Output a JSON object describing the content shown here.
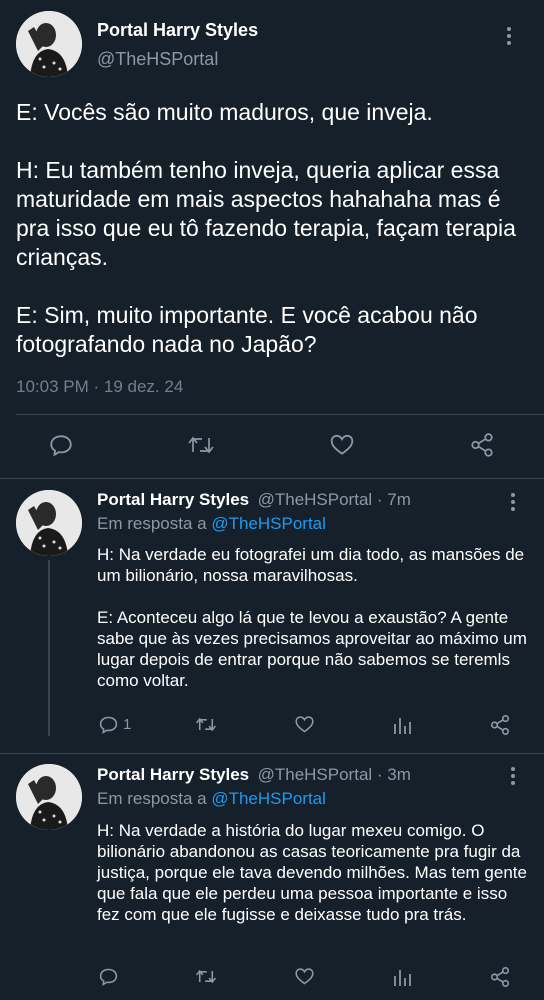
{
  "main_tweet": {
    "author_name": "Portal Harry Styles",
    "author_handle": "@TheHSPortal",
    "text": "E: Vocês são muito maduros, que inveja.\n\nH: Eu também tenho inveja, queria aplicar essa maturidade em mais aspectos hahahaha mas é pra isso que eu tô fazendo terapia, façam terapia crianças.\n\nE: Sim, muito importante. E você acabou não fotografando nada no Japão?",
    "timestamp": "10:03 PM · 19 dez. 24"
  },
  "replies": [
    {
      "author_name": "Portal Harry Styles",
      "author_handle": "@TheHSPortal · 7m",
      "reply_prefix": "Em resposta a ",
      "reply_to": "@TheHSPortal",
      "text": "H: Na verdade eu fotografei um dia todo, as mansões de um bilionário, nossa maravilhosas.\n\nE: Aconteceu algo lá que te levou a exaustão? A gente sabe que às vezes precisamos aproveitar ao máximo um lugar depois de entrar porque não sabemos se teremls como voltar.",
      "reply_count": "1"
    },
    {
      "author_name": "Portal Harry Styles",
      "author_handle": "@TheHSPortal · 3m",
      "reply_prefix": "Em resposta a ",
      "reply_to": "@TheHSPortal",
      "text": "H: Na verdade a história do lugar mexeu comigo. O bilionário abandonou as casas teoricamente pra fugir da justiça, porque ele tava devendo milhões. Mas tem gente que fala que ele perdeu uma pessoa importante e isso fez com que ele fugisse e deixasse tudo pra trás.",
      "reply_count": ""
    }
  ],
  "icons": {
    "reply": "reply-icon",
    "retweet": "retweet-icon",
    "like": "like-icon",
    "views": "views-icon",
    "share": "share-icon",
    "more": "more-icon"
  },
  "colors": {
    "background": "#15202b",
    "text": "#ffffff",
    "muted": "#8b98a5",
    "link": "#1d9bf0",
    "divider": "#38444d"
  }
}
